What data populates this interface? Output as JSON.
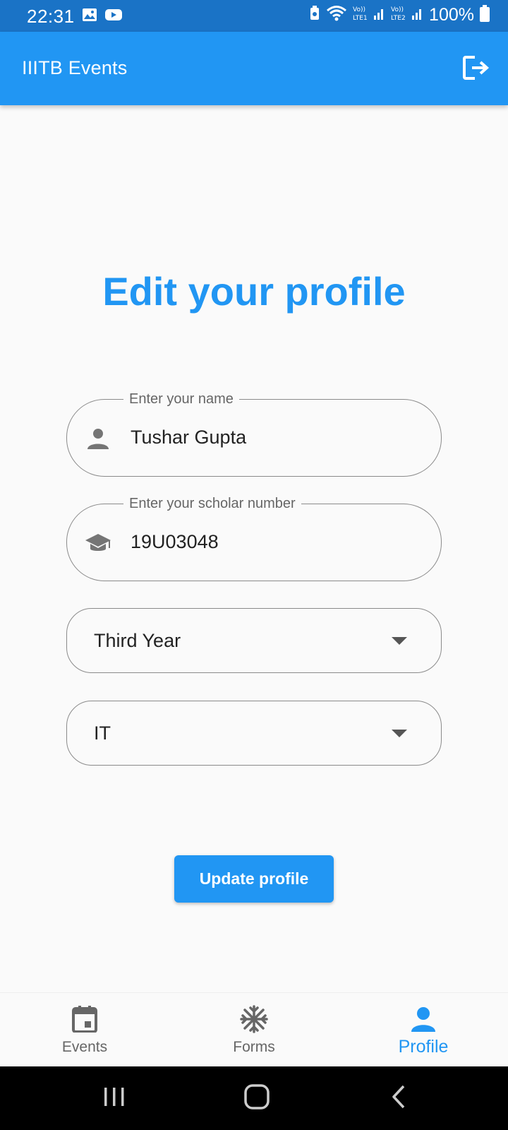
{
  "status_bar": {
    "time": "22:31",
    "battery": "100%",
    "icons": [
      "gallery-icon",
      "youtube-icon",
      "battery-saver-icon",
      "wifi-icon",
      "signal-lte1-icon",
      "signal-lte2-icon",
      "battery-icon"
    ]
  },
  "app_bar": {
    "title": "IIITB Events",
    "logout_icon": "logout-icon"
  },
  "heading": "Edit your profile",
  "form": {
    "name": {
      "label": "Enter your name",
      "value": "Tushar Gupta",
      "icon": "person-icon"
    },
    "scholar": {
      "label": "Enter your scholar number",
      "value": "19U03048",
      "icon": "graduation-cap-icon"
    },
    "year": {
      "selected": "Third Year"
    },
    "branch": {
      "selected": "IT"
    },
    "submit_label": "Update profile"
  },
  "bottom_nav": {
    "items": [
      {
        "label": "Events",
        "icon": "calendar-icon",
        "active": false
      },
      {
        "label": "Forms",
        "icon": "snowflake-icon",
        "active": false
      },
      {
        "label": "Profile",
        "icon": "person-icon",
        "active": true
      }
    ]
  },
  "colors": {
    "primary": "#2196f3",
    "status_bar": "#1a73c6",
    "background": "#fafafa",
    "inactive": "#666666"
  }
}
